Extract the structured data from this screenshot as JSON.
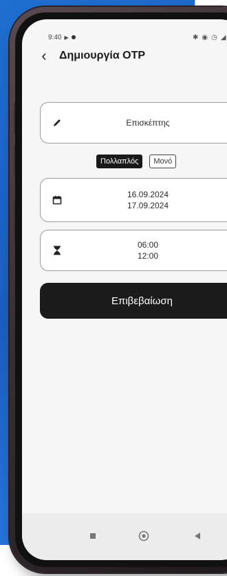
{
  "status_bar": {
    "time": "9:40",
    "icons": [
      "bluetooth-icon",
      "nfc-icon",
      "alarm-icon",
      "signal-icon"
    ]
  },
  "header": {
    "title": "Δημιουργία OTP"
  },
  "visitor": {
    "label": "Επισκέπτης"
  },
  "mode_toggle": {
    "multiple": "Πολλαπλός",
    "single": "Μονό",
    "selected": "multiple"
  },
  "dates": {
    "start": "16.09.2024",
    "end": "17.09.2024"
  },
  "times": {
    "start": "06:00",
    "end": "12:00"
  },
  "confirm_button": {
    "label": "Επιβεβαίωση"
  },
  "nav": {
    "icons": [
      "square-recent-icon",
      "circle-home-icon",
      "triangle-back-icon"
    ]
  },
  "colors": {
    "background_blue": "#1f6fd1",
    "button_dark": "#1b1b1b",
    "screen_bg": "#f6f6f6"
  }
}
